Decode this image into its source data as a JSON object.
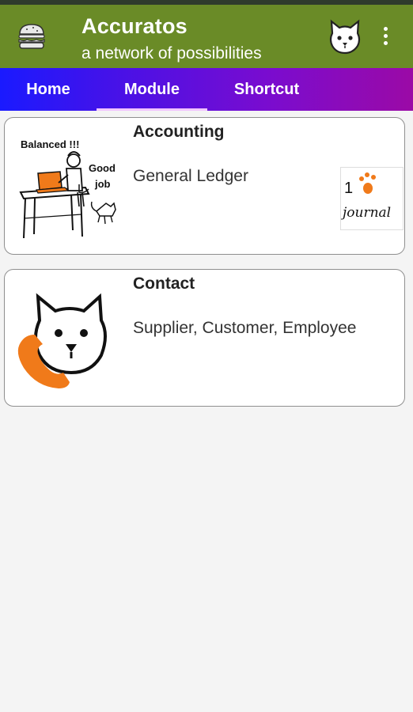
{
  "app": {
    "title": "Accuratos",
    "subtitle": "a network of possibilities"
  },
  "icons": {
    "menu": "burger-icon",
    "profile": "cat-face-icon",
    "more": "more-vert-icon"
  },
  "colors": {
    "appbar": "#6a8b27",
    "tab_gradient_start": "#1a1aff",
    "tab_gradient_end": "#9b0aa6",
    "accent_orange": "#f07a1a"
  },
  "tabs": [
    {
      "label": "Home",
      "selected": false
    },
    {
      "label": "Module",
      "selected": true
    },
    {
      "label": "Shortcut",
      "selected": false
    }
  ],
  "modules": [
    {
      "title": "Accounting",
      "description": "General Ledger",
      "illustration_text": [
        "Balanced !!!",
        "Good",
        "job"
      ],
      "badge_text": [
        "1",
        "journal"
      ]
    },
    {
      "title": "Contact",
      "description": "Supplier, Customer, Employee"
    }
  ]
}
